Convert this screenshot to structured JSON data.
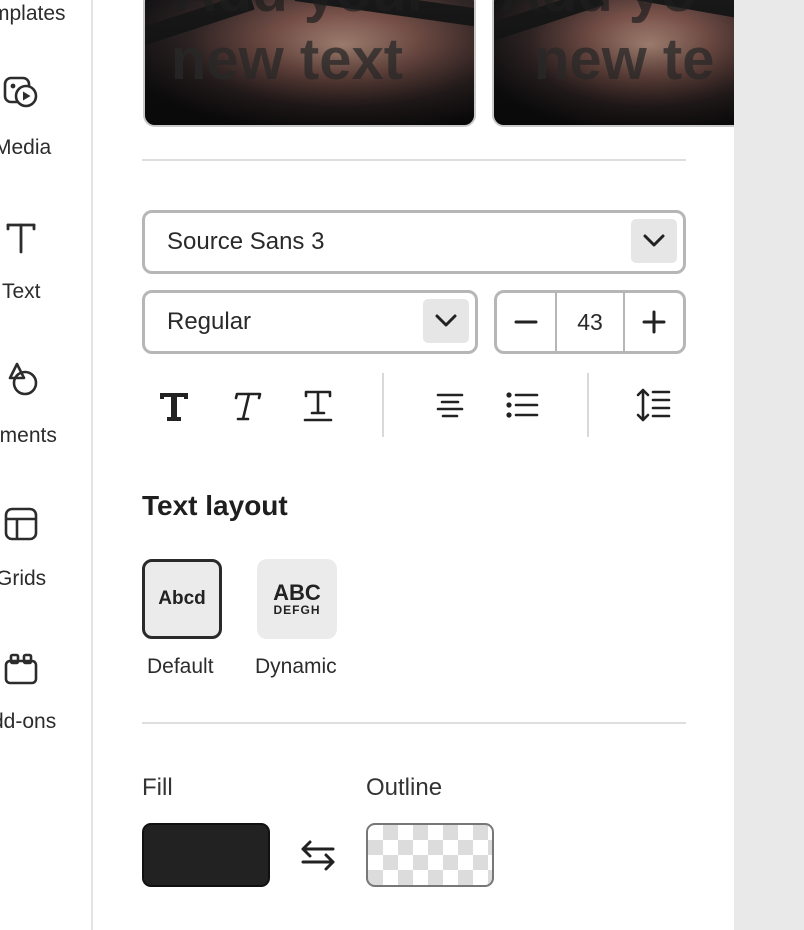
{
  "rail": {
    "items": [
      {
        "id": "templates",
        "label": "mplates",
        "icon": "templates-icon"
      },
      {
        "id": "media",
        "label": "Media",
        "icon": "media-icon"
      },
      {
        "id": "text",
        "label": "Text",
        "icon": "text-icon"
      },
      {
        "id": "elements",
        "label": "ements",
        "icon": "elements-icon"
      },
      {
        "id": "grids",
        "label": "Grids",
        "icon": "grids-icon"
      },
      {
        "id": "addons",
        "label": "dd-ons",
        "icon": "addons-icon"
      }
    ]
  },
  "thumbnails": [
    {
      "top_text": "Add your",
      "bottom_text": "new text"
    },
    {
      "top_text": "Add yo",
      "bottom_text": "new te"
    }
  ],
  "font": {
    "family": "Source Sans 3",
    "weight": "Regular",
    "size": "43"
  },
  "tools": {
    "bold": "bold-icon",
    "italic": "italic-icon",
    "underline": "underline-icon",
    "align": "align-center-icon",
    "list": "bullet-list-icon",
    "spacing": "line-spacing-icon"
  },
  "text_layout": {
    "heading": "Text layout",
    "options": [
      {
        "label": "Default",
        "preview": "Abcd",
        "selected": true
      },
      {
        "label": "Dynamic",
        "preview_top": "ABC",
        "preview_bottom": "DEFGH",
        "selected": false
      }
    ]
  },
  "colors": {
    "fill_label": "Fill",
    "outline_label": "Outline",
    "fill_color": "#222222",
    "outline_color": "transparent"
  }
}
